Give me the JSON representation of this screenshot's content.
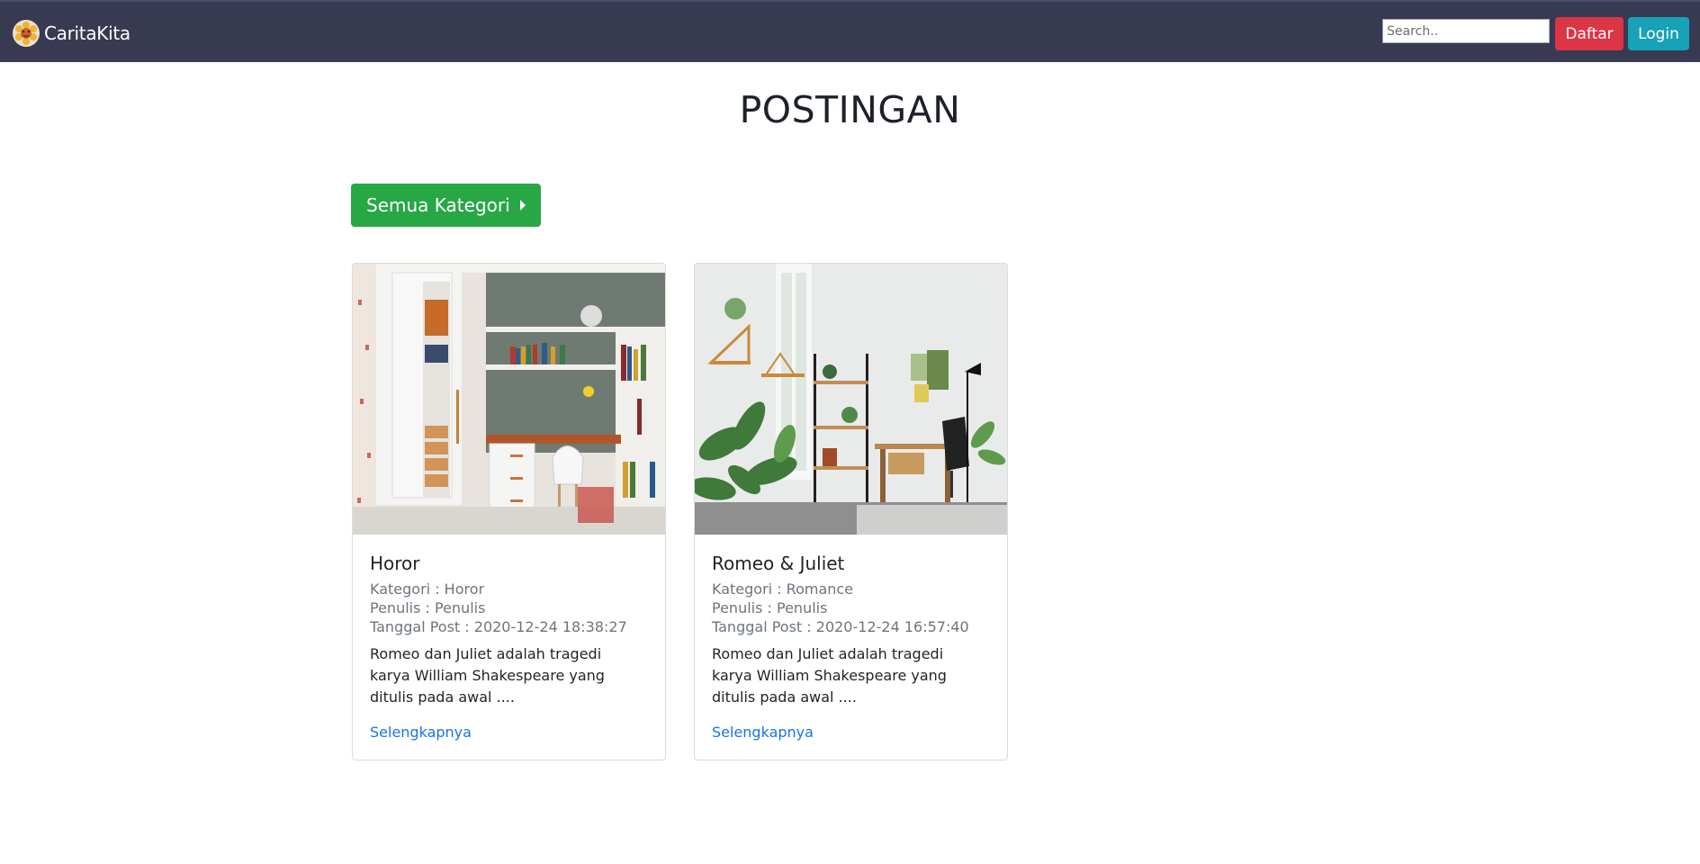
{
  "navbar": {
    "brand": "CaritaKita",
    "search_placeholder": "Search..",
    "daftar_label": "Daftar",
    "login_label": "Login"
  },
  "page": {
    "title": "POSTINGAN",
    "category_button": "Semua Kategori"
  },
  "posts": [
    {
      "title": "Horor",
      "kategori": "Kategori : Horor",
      "penulis": "Penulis : Penulis",
      "tanggal": "Tanggal Post : 2020-12-24 18:38:27",
      "excerpt": "Romeo dan Juliet adalah tragedi karya William Shakespeare yang ditulis pada awal ....",
      "link": "Selengkapnya",
      "image_alt": "bedroom-study-room-with-bookshelves-image"
    },
    {
      "title": "Romeo & Juliet",
      "kategori": "Kategori : Romance",
      "penulis": "Penulis : Penulis",
      "tanggal": "Tanggal Post : 2020-12-24 16:57:40",
      "excerpt": "Romeo dan Juliet adalah tragedi karya William Shakespeare yang ditulis pada awal ....",
      "link": "Selengkapnya",
      "image_alt": "room-with-plants-and-shelves-image"
    }
  ],
  "colors": {
    "navbar": "#373a51",
    "daftar": "#dc3545",
    "login": "#17a2b8",
    "category_button": "#28a745",
    "link": "#1a73e8"
  }
}
